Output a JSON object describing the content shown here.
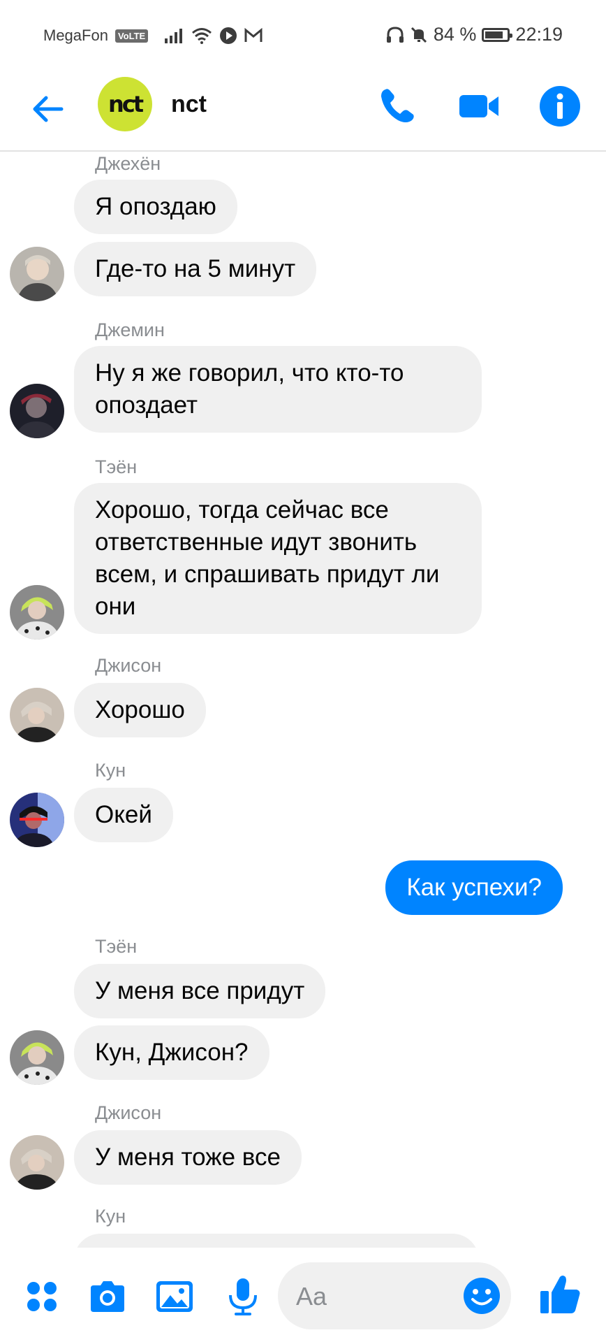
{
  "status_bar": {
    "carrier": "MegaFon",
    "volte": "VoLTE",
    "battery": "84 %",
    "battery_level": 0.84,
    "time": "22:19"
  },
  "header": {
    "title": "nct",
    "group_avatar_text": "nct",
    "icons": [
      "back-arrow-icon",
      "phone-icon",
      "video-camera-icon",
      "info-icon"
    ]
  },
  "messages": [
    {
      "sender": "Джехён",
      "bubbles": [
        "Я опоздаю",
        "Где-то на 5 минут"
      ]
    },
    {
      "sender": "Джемин",
      "bubbles": [
        "Ну я же говорил, что кто-то опоздает"
      ]
    },
    {
      "sender": "Тэён",
      "bubbles": [
        "Хорошо, тогда сейчас все ответственные идут звонить всем, и спрашивать придут ли они"
      ]
    },
    {
      "sender": "Джисон",
      "bubbles": [
        "Хорошо"
      ]
    },
    {
      "sender": "Кун",
      "bubbles": [
        "Окей"
      ]
    },
    {
      "sender": "me",
      "bubbles": [
        "Как успехи?"
      ]
    },
    {
      "sender": "Тэён",
      "bubbles": [
        "У меня все придут",
        "Кун, Джисон?"
      ]
    },
    {
      "sender": "Джисон",
      "bubbles": [
        "У меня тоже все"
      ]
    },
    {
      "sender": "Кун",
      "bubbles": []
    }
  ],
  "composer": {
    "placeholder": "Aa",
    "icons": [
      "menu-dots-icon",
      "camera-icon",
      "gallery-icon",
      "microphone-icon",
      "emoji-icon",
      "thumbs-up-icon"
    ]
  },
  "colors": {
    "accent": "#0084ff",
    "bubble_in": "#f0f0f0",
    "sender_name": "#8a8d91",
    "group_avatar": "#cde233"
  }
}
